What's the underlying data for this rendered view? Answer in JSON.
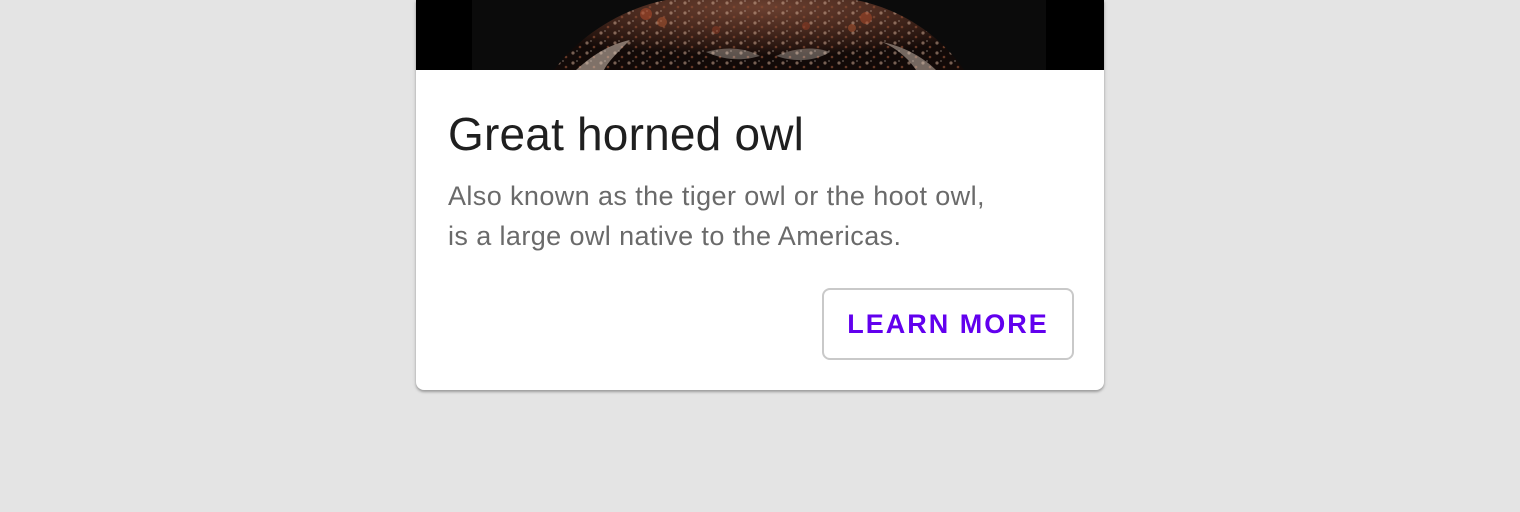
{
  "card": {
    "title": "Great horned owl",
    "description_lines": [
      "Also known as the tiger owl or the hoot owl,",
      "is a large owl native to the Americas."
    ],
    "action_label": "LEARN MORE",
    "media_icon": "owl-photo",
    "colors": {
      "accent": "#6200ee",
      "background": "#e4e4e4",
      "card": "#ffffff",
      "title": "#1f1f1f",
      "body": "#6a6a6a"
    }
  }
}
